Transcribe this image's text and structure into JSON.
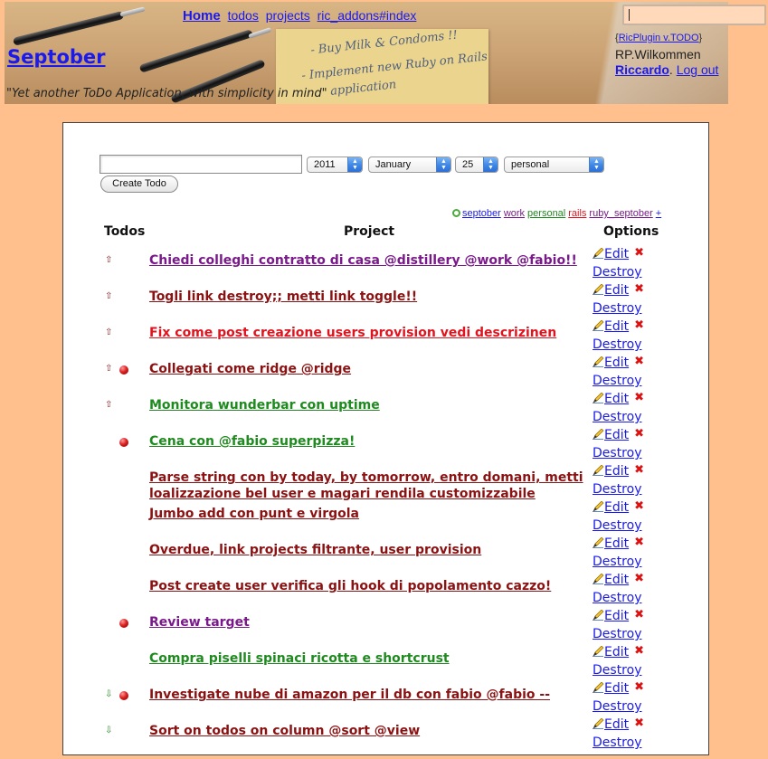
{
  "nav": {
    "home": "Home",
    "todos": "todos",
    "projects": "projects",
    "addons": "ric_addons#index"
  },
  "brand": "Septober",
  "tagline": "\"Yet another ToDo Application, with simplicity in mind\"",
  "sticky_notes": [
    "- Buy Milk & Condoms !!",
    "- Implement new Ruby on Rails",
    "application"
  ],
  "plugin": {
    "open": "{",
    "link": "RicPlugin v.TODO",
    "close": "}"
  },
  "welcome": "RP.Wilkommen",
  "user": {
    "name": "Riccardo",
    "separator": ". ",
    "logout": "Log out"
  },
  "form": {
    "year": "2011",
    "month": "January",
    "day": "25",
    "project": "personal",
    "create_label": "Create Todo"
  },
  "tags": [
    {
      "label": "septober",
      "color": "#1a1aee"
    },
    {
      "label": "work",
      "color": "#7a1a8a"
    },
    {
      "label": "personal",
      "color": "#1f8a1f"
    },
    {
      "label": "rails",
      "color": "#e0141e"
    },
    {
      "label": "ruby_septober",
      "color": "#7a1a8a"
    },
    {
      "label": "+",
      "color": "#1a1aee"
    }
  ],
  "columns": {
    "todos": "Todos",
    "project": "Project",
    "options": "Options"
  },
  "options": {
    "edit": "Edit",
    "destroy": "Destroy"
  },
  "todos": [
    {
      "title": "Chiedi colleghi contratto di casa @distillery @work @fabio!!",
      "color": "#7a1a8a",
      "priority": "up",
      "flag": false
    },
    {
      "title": "Togli link destroy;; metti link toggle!!",
      "color": "#8b1212",
      "priority": "up",
      "flag": false
    },
    {
      "title": "Fix come post creazione users provision vedi descrizinen",
      "color": "#e0141e",
      "priority": "up",
      "flag": false
    },
    {
      "title": "Collegati come ridge @ridge",
      "color": "#8b1212",
      "priority": "up",
      "flag": true
    },
    {
      "title": "Monitora wunderbar con uptime",
      "color": "#1f8a1f",
      "priority": "up",
      "flag": false
    },
    {
      "title": "Cena con @fabio superpizza!",
      "color": "#1f8a1f",
      "priority": "none",
      "flag": true
    },
    {
      "title": "Parse string con by today, by tomorrow, entro domani, metti loalizzazione bel user e magari rendila customizzabile",
      "color": "#8b1212",
      "priority": "none",
      "flag": false
    },
    {
      "title": "Jumbo add con punt e virgola",
      "color": "#8b1212",
      "priority": "none",
      "flag": false
    },
    {
      "title": "Overdue, link projects filtrante, user provision",
      "color": "#8b1212",
      "priority": "none",
      "flag": false
    },
    {
      "title": "Post create user verifica gli hook di popolamento cazzo!",
      "color": "#8b1212",
      "priority": "none",
      "flag": false
    },
    {
      "title": "Review target",
      "color": "#7a1a8a",
      "priority": "none",
      "flag": true
    },
    {
      "title": "Compra piselli spinaci ricotta e shortcrust",
      "color": "#1f8a1f",
      "priority": "none",
      "flag": false
    },
    {
      "title": "Investigate nube di amazon per il db con fabio @fabio --",
      "color": "#8b1212",
      "priority": "down",
      "flag": true
    },
    {
      "title": "Sort on todos on column @sort @view",
      "color": "#8b1212",
      "priority": "down",
      "flag": false
    }
  ]
}
